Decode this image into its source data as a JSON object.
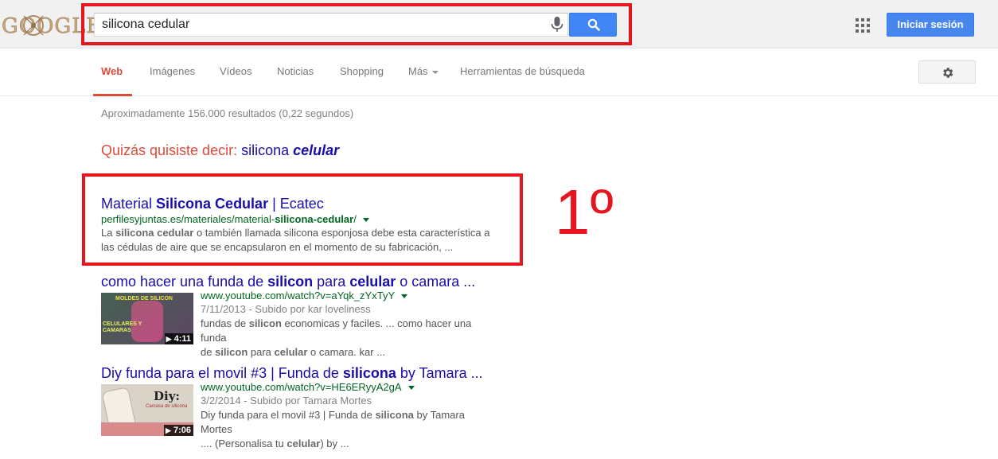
{
  "header": {
    "logo_text": "GOOGLE",
    "search_value": "silicona cedular",
    "signin_label": "Iniciar sesión",
    "mic_icon": "mic-icon",
    "search_icon": "search-icon",
    "apps_icon": "apps-grid-icon"
  },
  "tabs": [
    {
      "label": "Web",
      "active": true
    },
    {
      "label": "Imágenes"
    },
    {
      "label": "Vídeos"
    },
    {
      "label": "Noticias"
    },
    {
      "label": "Shopping"
    },
    {
      "label": "Más"
    },
    {
      "label": "Herramientas de búsqueda"
    }
  ],
  "settings_icon": "gear-icon",
  "stats": "Aproximadamente 156.000 resultados (0,22 segundos)",
  "spell": {
    "prefix": "Quizás quisiste decir:",
    "plain": "silicona",
    "emph": "celular"
  },
  "annotation": {
    "rank_label": "1º",
    "accent": "#e5161f"
  },
  "results": [
    {
      "title_parts": [
        "Material ",
        "Silicona Cedular",
        " | Ecatec"
      ],
      "url_parts": [
        "perfilesyjuntas.es/materiales/material-",
        "silicona-cedular",
        "/"
      ],
      "snippet_line1_parts": [
        "La ",
        "silicona cedular",
        " o también llamada silicona esponjosa debe esta característica a"
      ],
      "snippet_line2": "las cédulas de aire que se encapsularon en el momento de su fabricación, ..."
    },
    {
      "title_parts": [
        "como hacer una funda de ",
        "silicon",
        " para ",
        "celular",
        " o camara ..."
      ],
      "url": "www.youtube.com/watch?v=aYqk_zYxTyY",
      "meta": "7/11/2013 - Subido por kar loveliness",
      "snippet_line1_parts": [
        "fundas de ",
        "silicon",
        " economicas y faciles. ... como hacer una funda"
      ],
      "snippet_line2_parts": [
        "de ",
        "silicon",
        " para ",
        "celular",
        " o camara. kar ..."
      ],
      "duration": "4:11",
      "thumb_text1": "MOLDES DE SILICON",
      "thumb_text2": "CELULARES Y CAMARAS"
    },
    {
      "title_parts": [
        "Diy funda para el movil #3 | Funda de ",
        "silicona",
        " by Tamara ..."
      ],
      "url": "www.youtube.com/watch?v=HE6ERyyA2gA",
      "meta": "3/2/2014 - Subido por Tamara Mortes",
      "snippet_line1_parts": [
        "Diy funda para el movil #3 | Funda de ",
        "silicona",
        " by Tamara Mortes"
      ],
      "snippet_line2_parts": [
        ".... (Personalisa tu ",
        "celular",
        ") by ..."
      ],
      "duration": "7:06",
      "thumb_text1": "Diy:",
      "thumb_text2": "Carcasa de silicona"
    }
  ]
}
